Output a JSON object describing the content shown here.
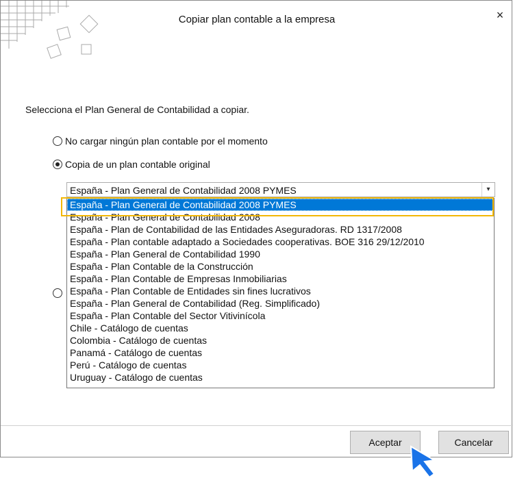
{
  "window": {
    "title": "Copiar plan contable a la empresa",
    "close_label": "×"
  },
  "instruction": "Selecciona el Plan General de Contabilidad a copiar.",
  "radios": [
    {
      "label": "No cargar ningún plan contable por el momento",
      "checked": false
    },
    {
      "label": "Copia de un plan contable original",
      "checked": true
    }
  ],
  "combo": {
    "selected_value": "España - Plan General de Contabilidad 2008 PYMES",
    "arrow_icon": "chevron-down-icon"
  },
  "dropdown": {
    "items": [
      "España - Plan General de Contabilidad 2008 PYMES",
      "España - Plan General de Contabilidad 2008",
      "España - Plan de Contabilidad de las Entidades Aseguradoras. RD 1317/2008",
      "España - Plan contable adaptado a Sociedades cooperativas. BOE 316 29/12/2010",
      "España - Plan General de Contabilidad 1990",
      "España - Plan Contable de la Construcción",
      "España - Plan Contable de Empresas Inmobiliarias",
      "España - Plan Contable de Entidades sin fines lucrativos",
      "España - Plan General de Contabilidad (Reg. Simplificado)",
      "España - Plan Contable del Sector Vitivinícola",
      "Chile - Catálogo de cuentas",
      "Colombia - Catálogo de cuentas",
      "Panamá - Catálogo de cuentas",
      "Perú - Catálogo de cuentas",
      "Uruguay - Catálogo de cuentas"
    ],
    "selected_index": 0
  },
  "buttons": {
    "accept": "Aceptar",
    "cancel": "Cancelar"
  },
  "colors": {
    "selection": "#0078d7",
    "highlight": "#f2b705",
    "pointer": "#1a73e8"
  }
}
